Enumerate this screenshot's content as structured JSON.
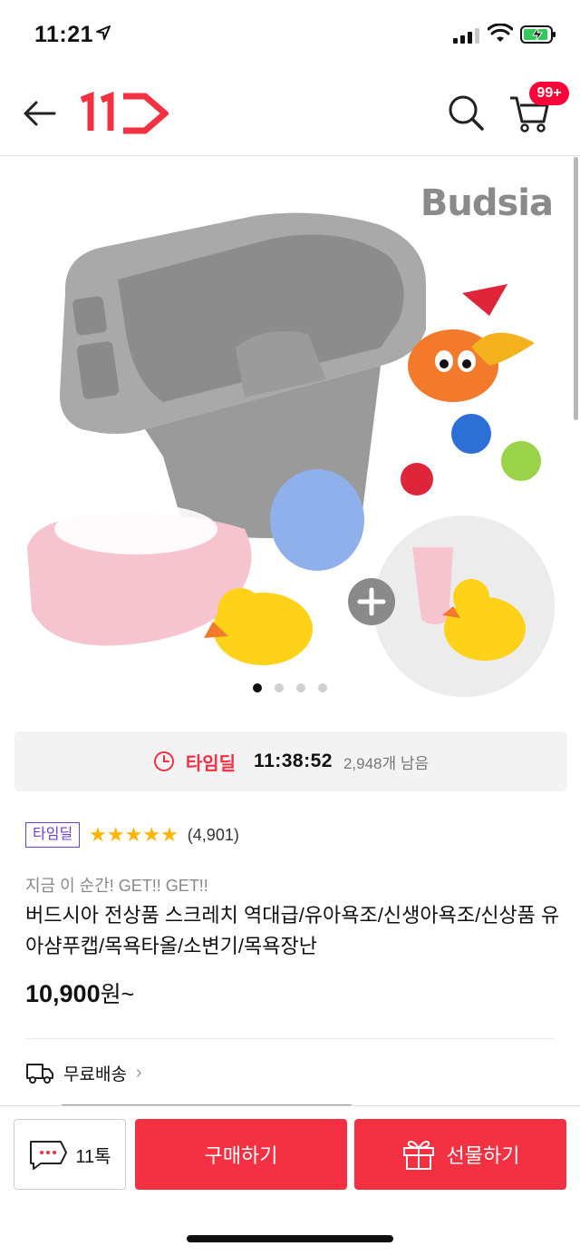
{
  "status_bar": {
    "time": "11:21",
    "location_icon": "location-arrow-icon",
    "signal_icon": "cellular-signal-icon",
    "wifi_icon": "wifi-icon",
    "battery_icon": "battery-charging-icon"
  },
  "header": {
    "back_icon": "back-arrow-icon",
    "logo_text": "11ST",
    "search_icon": "search-icon",
    "cart_icon": "cart-icon",
    "cart_badge": "99+"
  },
  "product_image": {
    "brand": "Budsia",
    "carousel_total": 4,
    "carousel_active": 1
  },
  "time_deal": {
    "icon": "clock-icon",
    "label": "타임딜",
    "countdown": "11:38:52",
    "remaining": "2,948개 남음"
  },
  "product": {
    "deal_tag": "타임딜",
    "stars": "★★★★★",
    "review_count": "(4,901)",
    "promo_text": "지금 이 순간! GET!! GET!!",
    "title": "버드시아 전상품 스크레치 역대급/유아욕조/신생아욕조/신상품 유아샴푸캡/목욕타올/소변기/목욕장난",
    "price_value": "10,900",
    "price_unit": "원~"
  },
  "shipping": {
    "icon": "truck-icon",
    "label": "무료배송",
    "chevron": "›"
  },
  "bottom_bar": {
    "talk_icon": "chat-bubble-icon",
    "talk_label": "11톡",
    "buy_label": "구매하기",
    "gift_icon": "gift-icon",
    "gift_label": "선물하기"
  },
  "colors": {
    "brand_red": "#f43142",
    "badge_red": "#ff0038",
    "deal_purple": "#6e3fd8",
    "star_yellow": "#ffb400"
  }
}
